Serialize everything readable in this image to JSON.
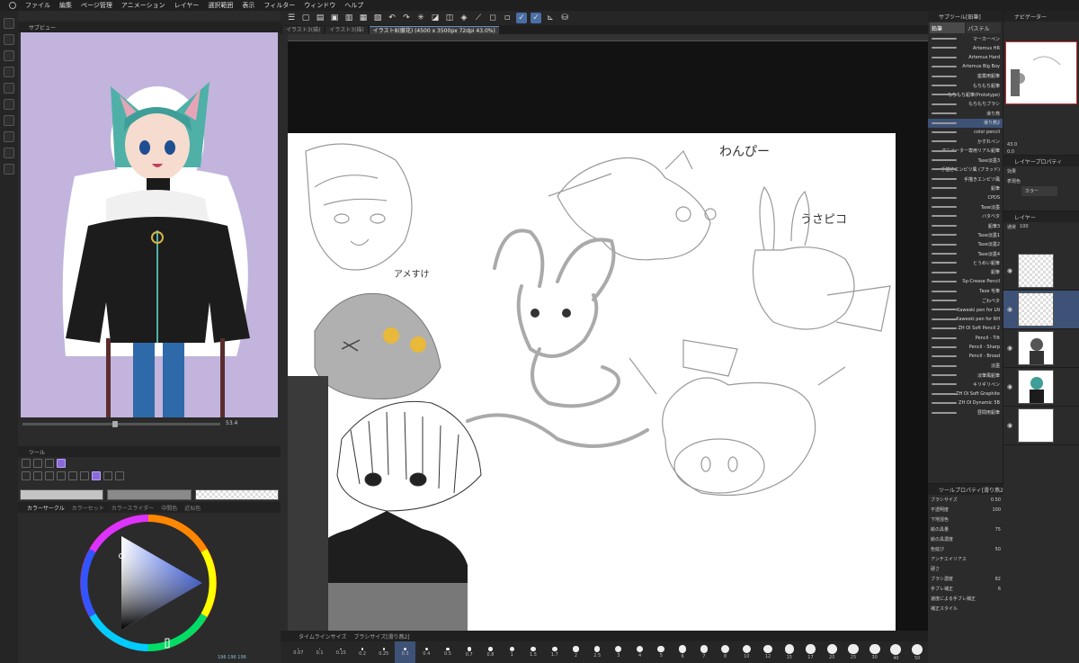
{
  "menu": [
    "ファイル",
    "編集",
    "ページ管理",
    "アニメーション",
    "レイヤー",
    "選択範囲",
    "表示",
    "フィルター",
    "ウィンドウ",
    "ヘルプ"
  ],
  "tabs": [
    {
      "label": "イラスト3(描)"
    },
    {
      "label": "イラスト3(描)"
    },
    {
      "label": "イラスト8(撤花) (4500 x 3500px 72dpi 43.0%)"
    }
  ],
  "subview": {
    "title": "サブビュー",
    "zoom": "53.4"
  },
  "toolpanel": {
    "title": "ツール"
  },
  "colorpanel": {
    "tabs": [
      "カラーサークル",
      "カラーセット",
      "カラースライダー",
      "中間色",
      "近似色",
      "カラー履歴"
    ],
    "rgb": "196 196 196"
  },
  "subtool": {
    "header": "サブツール[鉛筆]",
    "tabs": [
      "鉛筆",
      "パステル"
    ],
    "brushes": [
      "マーカーペン",
      "Artemus HR",
      "Artemus Hard",
      "Artemus Big Boy",
      "座薬用鉛筆",
      "もちもち鉛筆",
      "もちもち鉛筆(Prototype)",
      "もちもちブラシ",
      "滑り燕",
      "滑り燕2",
      "color pencil",
      "かすれペン",
      "アニメーター専用リアル鉛筆",
      "Taxe淡墨3",
      "手描きエンピツ風 (ブラッド)",
      "手描きエンピツ風",
      "鉛筆",
      "CPDS",
      "Taxe淡墨",
      "バタベタ",
      "鉛筆3",
      "Taxe淡墨1",
      "Taxe淡墨2",
      "Taxe淡墨4",
      "とうめい鉛筆",
      "鉛筆",
      "Sp-Crease Pencil",
      "Taxe 毛筆",
      "ごわベタ",
      "Kaweski pen for LN",
      "Kaweski pen for RH",
      "ZH Ol Soft Pencil 2",
      "Pencil - Tilt",
      "Pencil - Sharp",
      "Pencil - Broad",
      "淡墨",
      "淡筆風鉛筆",
      "キリギリペン",
      "ZH Ol Soft Graphite",
      "ZH Ol Dynamic 5B",
      "昼間用鉛筆"
    ],
    "selected_index": 9
  },
  "toolprop": {
    "title": "ツールプロパティ[滑り燕2]",
    "rows": [
      {
        "label": "ブラシサイズ",
        "value": "0.50"
      },
      {
        "label": "不透明度",
        "value": "100"
      },
      {
        "label": "下地混色",
        "value": ""
      },
      {
        "label": "絵の具量",
        "value": "75"
      },
      {
        "label": "絵の具濃度",
        "value": ""
      },
      {
        "label": "色延び",
        "value": "50"
      },
      {
        "label": "アンチエイリアス",
        "value": ""
      },
      {
        "label": "硬さ",
        "value": ""
      },
      {
        "label": "ブラシ濃度",
        "value": "82"
      },
      {
        "label": "手ブレ補正",
        "value": "6"
      },
      {
        "label": "速度による手ブレ補正",
        "value": ""
      },
      {
        "label": "補正スタイル",
        "value": ""
      }
    ]
  },
  "navigator": {
    "title": "ナビゲーター",
    "zoom": "43.0",
    "angle": "0.0"
  },
  "layerprop": {
    "title": "レイヤープロパティ",
    "effect": "効果",
    "color_label": "表現色",
    "color_value": "カラー"
  },
  "layers": {
    "title": "レイヤー",
    "blend": "通常",
    "opacity": "100"
  },
  "canvas_labels": {
    "wanpi": "わんぴー",
    "usapiko": "うさピコ",
    "ameboshi": "アメすけ"
  },
  "brush_sizes": [
    {
      "label": "0.07"
    },
    {
      "label": "0.1"
    },
    {
      "label": "0.15"
    },
    {
      "label": "0.2"
    },
    {
      "label": "0.25"
    },
    {
      "label": "0.3"
    },
    {
      "label": "0.4"
    },
    {
      "label": "0.5"
    },
    {
      "label": "0.7"
    },
    {
      "label": "0.8"
    },
    {
      "label": "1"
    },
    {
      "label": "1.5"
    },
    {
      "label": "1.7"
    },
    {
      "label": "2"
    },
    {
      "label": "2.5"
    },
    {
      "label": "3"
    },
    {
      "label": "4"
    },
    {
      "label": "5"
    },
    {
      "label": "6"
    },
    {
      "label": "7"
    },
    {
      "label": "8"
    },
    {
      "label": "10"
    },
    {
      "label": "12"
    },
    {
      "label": "15"
    },
    {
      "label": "17"
    },
    {
      "label": "20"
    },
    {
      "label": "25"
    },
    {
      "label": "30"
    },
    {
      "label": "40"
    },
    {
      "label": "50"
    }
  ],
  "brush_size_selected": 5,
  "bottom_tabs": [
    "タイムラインサイズ",
    "ブラシサイズ[滑り燕2]"
  ],
  "colors": {
    "accent": "#3d5276",
    "preview_bg": "#c2b4dc",
    "canvas": "#ffffff",
    "sketch_gray": "#a0a0a0"
  }
}
